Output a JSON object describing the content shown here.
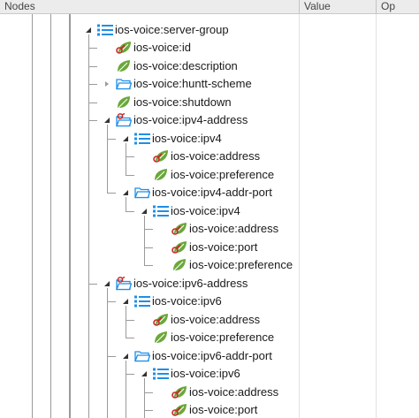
{
  "header": {
    "nodes_label": "Nodes",
    "value_label": "Value",
    "op_label": "Op"
  },
  "colors": {
    "list_icon": "#1e8fe6",
    "folder_icon": "#1e8fe6",
    "leaf_green": "#6aa83a",
    "key_red": "#c8282a",
    "guide_line": "#9a9a9a"
  },
  "tree": [
    {
      "label": "ios-voice:server-group",
      "icon": "list-icon",
      "depth": 2,
      "expanded": true
    },
    {
      "label": "ios-voice:id",
      "icon": "key-leaf-icon",
      "depth": 3
    },
    {
      "label": "ios-voice:description",
      "icon": "leaf-icon",
      "depth": 3
    },
    {
      "label": "ios-voice:huntt-scheme",
      "icon": "folder-icon",
      "depth": 3,
      "expanded": false
    },
    {
      "label": "ios-voice:shutdown",
      "icon": "leaf-icon",
      "depth": 3
    },
    {
      "label": "ios-voice:ipv4-address",
      "icon": "folder-key-icon",
      "depth": 3,
      "expanded": true
    },
    {
      "label": "ios-voice:ipv4",
      "icon": "list-icon",
      "depth": 4,
      "expanded": true
    },
    {
      "label": "ios-voice:address",
      "icon": "key-leaf-icon",
      "depth": 5
    },
    {
      "label": "ios-voice:preference",
      "icon": "leaf-icon",
      "depth": 5
    },
    {
      "label": "ios-voice:ipv4-addr-port",
      "icon": "folder-icon",
      "depth": 4,
      "expanded": true
    },
    {
      "label": "ios-voice:ipv4",
      "icon": "list-icon",
      "depth": 5,
      "expanded": true
    },
    {
      "label": "ios-voice:address",
      "icon": "key-leaf-icon",
      "depth": 6
    },
    {
      "label": "ios-voice:port",
      "icon": "key-leaf-icon",
      "depth": 6
    },
    {
      "label": "ios-voice:preference",
      "icon": "leaf-icon",
      "depth": 6
    },
    {
      "label": "ios-voice:ipv6-address",
      "icon": "folder-key-icon",
      "depth": 3,
      "expanded": true
    },
    {
      "label": "ios-voice:ipv6",
      "icon": "list-icon",
      "depth": 4,
      "expanded": true
    },
    {
      "label": "ios-voice:address",
      "icon": "key-leaf-icon",
      "depth": 5
    },
    {
      "label": "ios-voice:preference",
      "icon": "leaf-icon",
      "depth": 5
    },
    {
      "label": "ios-voice:ipv6-addr-port",
      "icon": "folder-icon",
      "depth": 4,
      "expanded": true
    },
    {
      "label": "ios-voice:ipv6",
      "icon": "list-icon",
      "depth": 5,
      "expanded": true
    },
    {
      "label": "ios-voice:address",
      "icon": "key-leaf-icon",
      "depth": 6
    },
    {
      "label": "ios-voice:port",
      "icon": "key-leaf-icon",
      "depth": 6
    }
  ]
}
